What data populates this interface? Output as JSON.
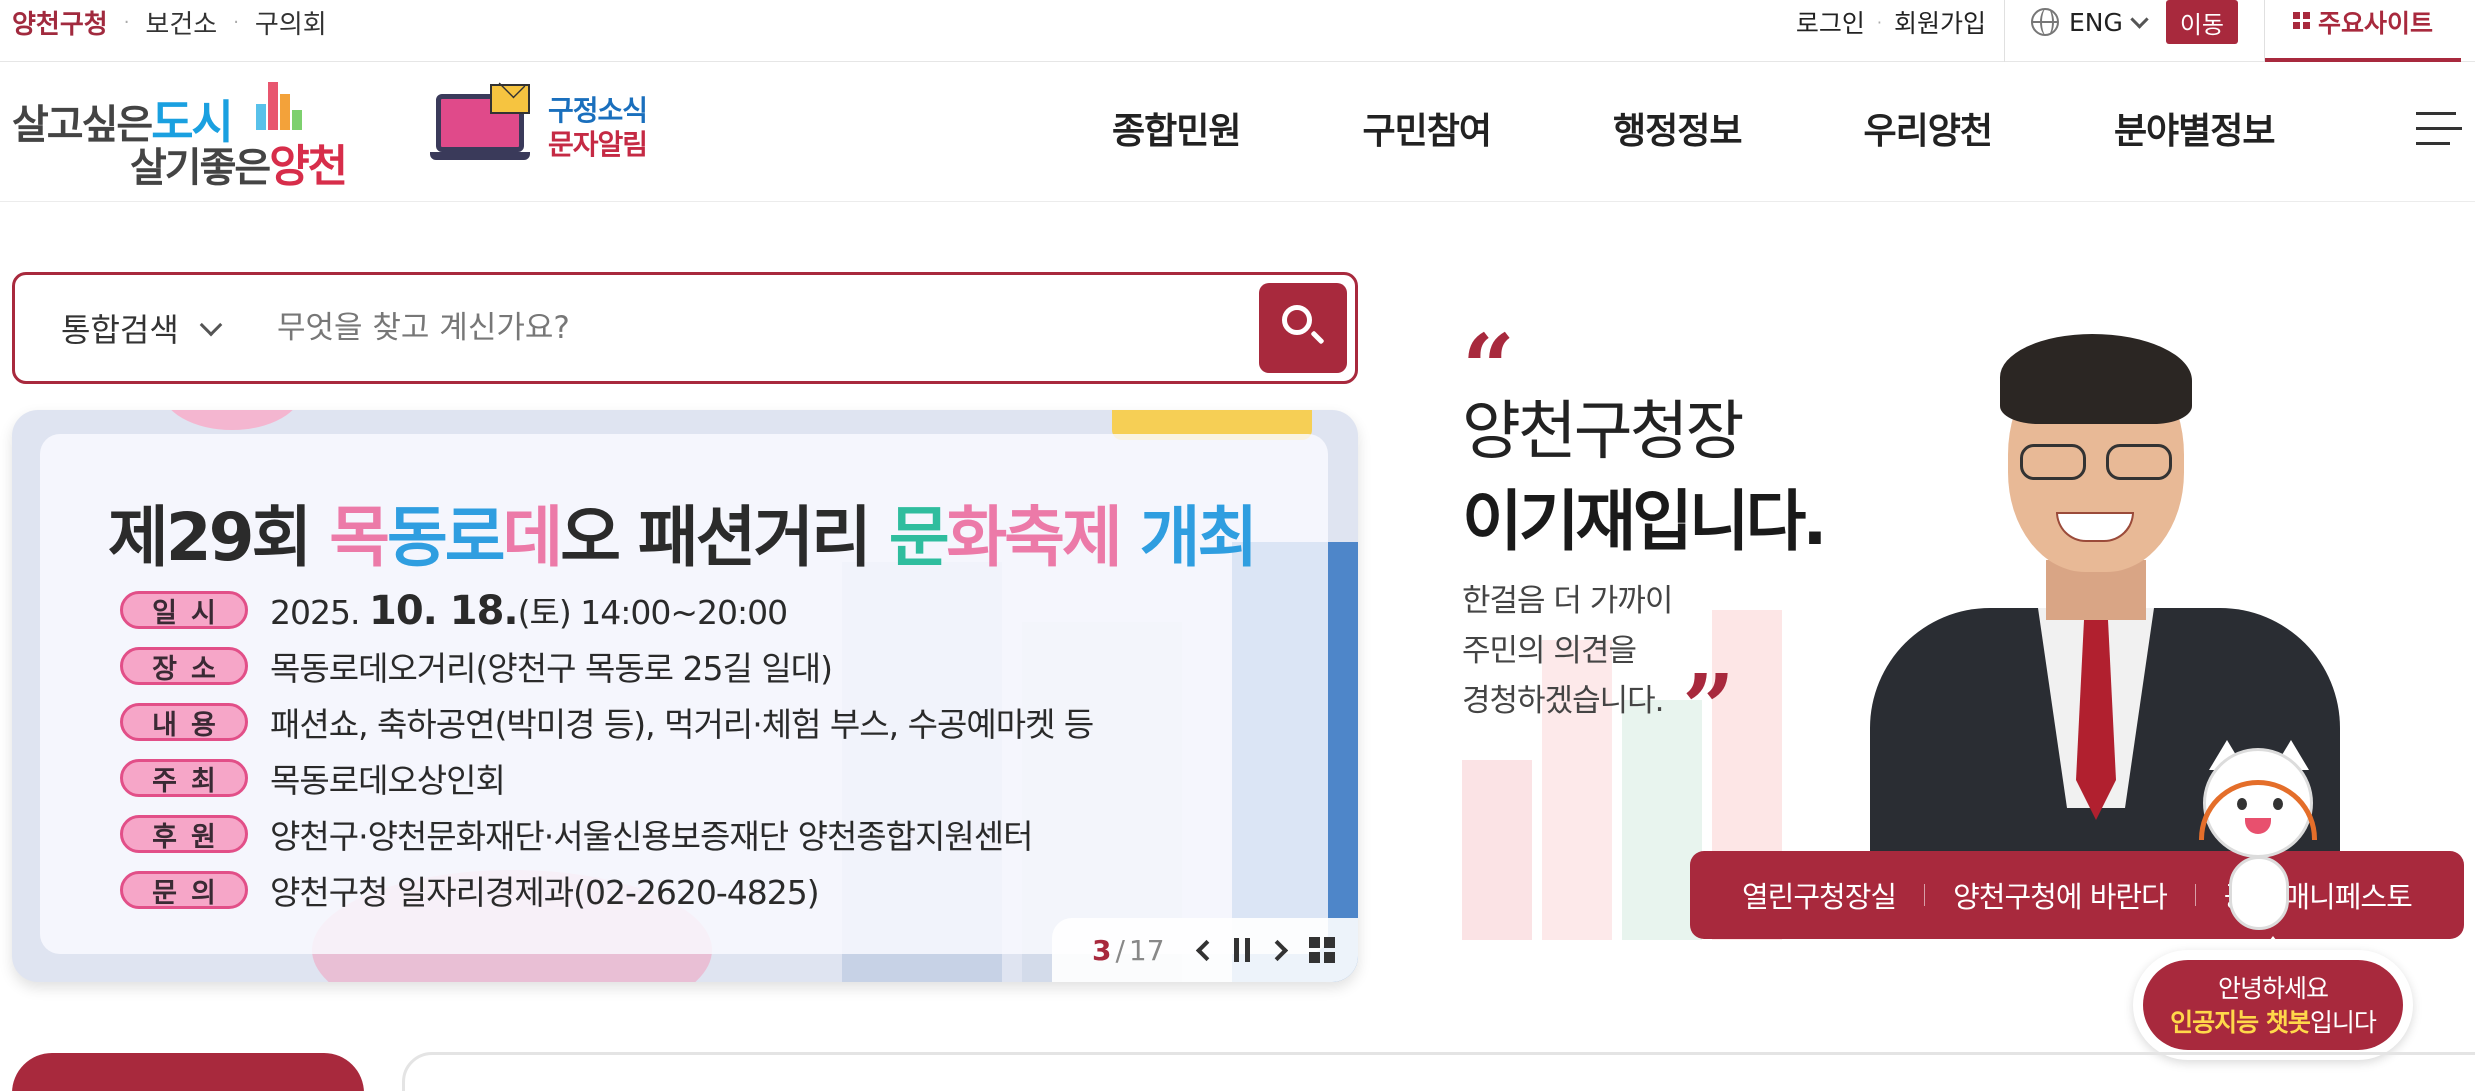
{
  "utility_bar": {
    "links": [
      "양천구청",
      "보건소",
      "구의회"
    ],
    "login": "로그인",
    "signup": "회원가입",
    "language": "ENG",
    "go_button": "이동",
    "main_sites": "주요사이트"
  },
  "header": {
    "logo_line1": "살고싶은",
    "logo_line1_accent": "도시",
    "logo_line2": "살기좋은",
    "logo_line2_accent": "양천",
    "sms_line1": "구정소식",
    "sms_line2": "문자알림",
    "nav": [
      "종합민원",
      "구민참여",
      "행정정보",
      "우리양천",
      "분야별정보"
    ]
  },
  "search": {
    "scope": "통합검색",
    "placeholder": "무엇을 찾고 계신가요?"
  },
  "banner": {
    "title_prefix": "제29회",
    "title_parts": [
      "목",
      "동",
      "로",
      "데",
      "오"
    ],
    "title_mid": "패션거리",
    "title_parts2": [
      "문",
      "화",
      "축",
      "제"
    ],
    "title_end": "개최",
    "rows": [
      {
        "label": "일시",
        "value_pre": "2025.",
        "value_big": "10. 18.",
        "value_post": "(토) 14:00~20:00"
      },
      {
        "label": "장소",
        "value": "목동로데오거리(양천구 목동로 25길 일대)"
      },
      {
        "label": "내용",
        "value": "패션쇼, 축하공연(박미경 등), 먹거리·체험 부스, 수공예마켓 등"
      },
      {
        "label": "주최",
        "value": "목동로데오상인회"
      },
      {
        "label": "후원",
        "value": "양천구·양천문화재단·서울신용보증재단 양천종합지원센터"
      },
      {
        "label": "문의",
        "value": "양천구청 일자리경제과(02-2620-4825)"
      }
    ],
    "pager": {
      "current": "3",
      "separator": "/",
      "total": "17"
    }
  },
  "mayor": {
    "title_line1": "양천구청장",
    "title_line2": "이기재입니다.",
    "desc": [
      "한걸음 더 가까이",
      "주민의 의견을",
      "경청하겠습니다."
    ],
    "links": [
      "열린구청장실",
      "양천구청에 바란다",
      "공약 매니페스토"
    ]
  },
  "chatbot": {
    "line1": "안녕하세요",
    "highlight": "인공지능 챗봇",
    "line2_suffix": "입니다"
  },
  "colors": {
    "brand": "#a8293d",
    "logo_blue": "#1aa0e0",
    "logo_red": "#d72d4a",
    "pink_label": "#f6a6c8"
  }
}
